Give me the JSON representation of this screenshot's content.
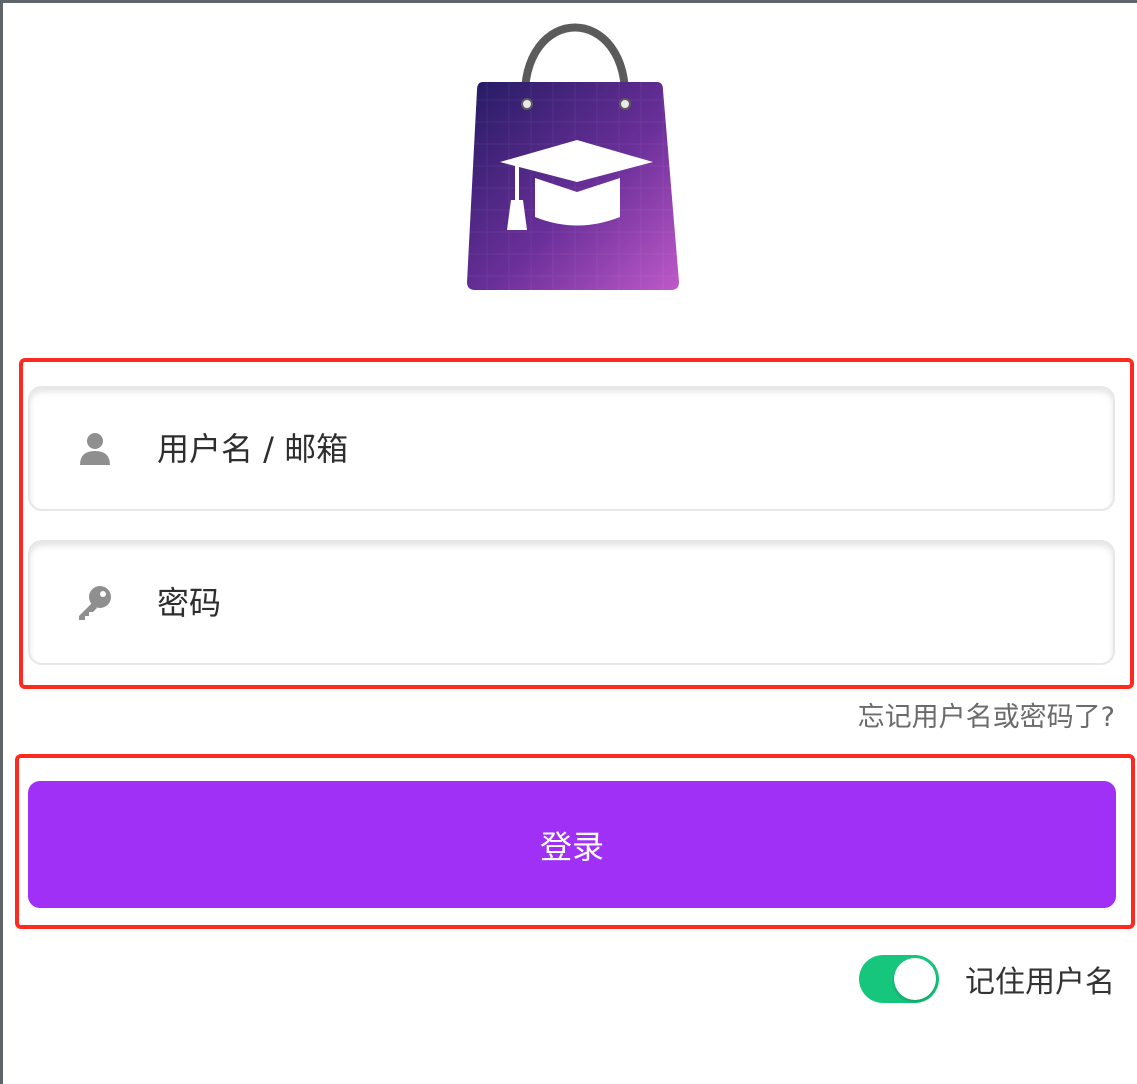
{
  "logo": {
    "icon": "shopping-bag-graduation-cap-icon"
  },
  "form": {
    "username": {
      "placeholder": "用户名 / 邮箱",
      "value": "",
      "icon": "user-icon"
    },
    "password": {
      "placeholder": "密码",
      "value": "",
      "icon": "key-icon"
    },
    "forgot_link": "忘记用户名或密码了?",
    "login_label": "登录",
    "remember": {
      "label": "记住用户名",
      "checked": true
    }
  },
  "colors": {
    "accent": "#a030f5",
    "toggle_on": "#17c67d",
    "annotation": "#ff2a1f"
  }
}
